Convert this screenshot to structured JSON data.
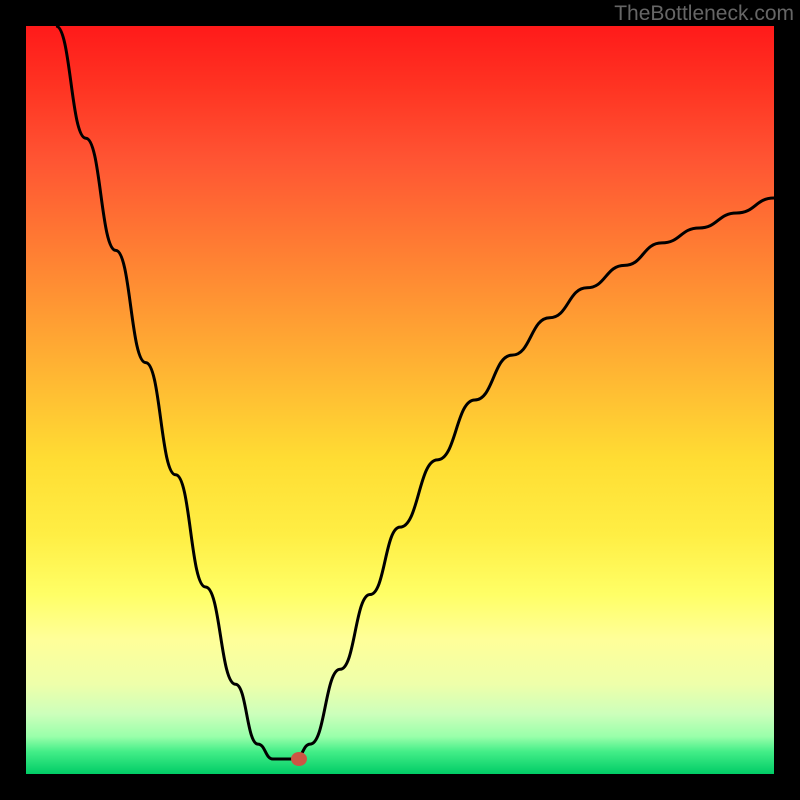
{
  "watermark": "TheBottleneck.com",
  "chart_data": {
    "type": "line",
    "title": "",
    "xlabel": "",
    "ylabel": "",
    "x_range": [
      0,
      100
    ],
    "y_range": [
      0,
      100
    ],
    "curve_points": [
      {
        "x": 4,
        "y": 100
      },
      {
        "x": 8,
        "y": 85
      },
      {
        "x": 12,
        "y": 70
      },
      {
        "x": 16,
        "y": 55
      },
      {
        "x": 20,
        "y": 40
      },
      {
        "x": 24,
        "y": 25
      },
      {
        "x": 28,
        "y": 12
      },
      {
        "x": 31,
        "y": 4
      },
      {
        "x": 33,
        "y": 2
      },
      {
        "x": 36,
        "y": 2
      },
      {
        "x": 38,
        "y": 4
      },
      {
        "x": 42,
        "y": 14
      },
      {
        "x": 46,
        "y": 24
      },
      {
        "x": 50,
        "y": 33
      },
      {
        "x": 55,
        "y": 42
      },
      {
        "x": 60,
        "y": 50
      },
      {
        "x": 65,
        "y": 56
      },
      {
        "x": 70,
        "y": 61
      },
      {
        "x": 75,
        "y": 65
      },
      {
        "x": 80,
        "y": 68
      },
      {
        "x": 85,
        "y": 71
      },
      {
        "x": 90,
        "y": 73
      },
      {
        "x": 95,
        "y": 75
      },
      {
        "x": 100,
        "y": 77
      }
    ],
    "marker": {
      "x": 36.5,
      "y": 2
    },
    "background": "rainbow-gradient-vertical",
    "colors": {
      "top": "#ff1a1a",
      "bottom": "#00cc66",
      "curve": "#000000",
      "marker": "#cc5544",
      "border": "#000000"
    }
  }
}
